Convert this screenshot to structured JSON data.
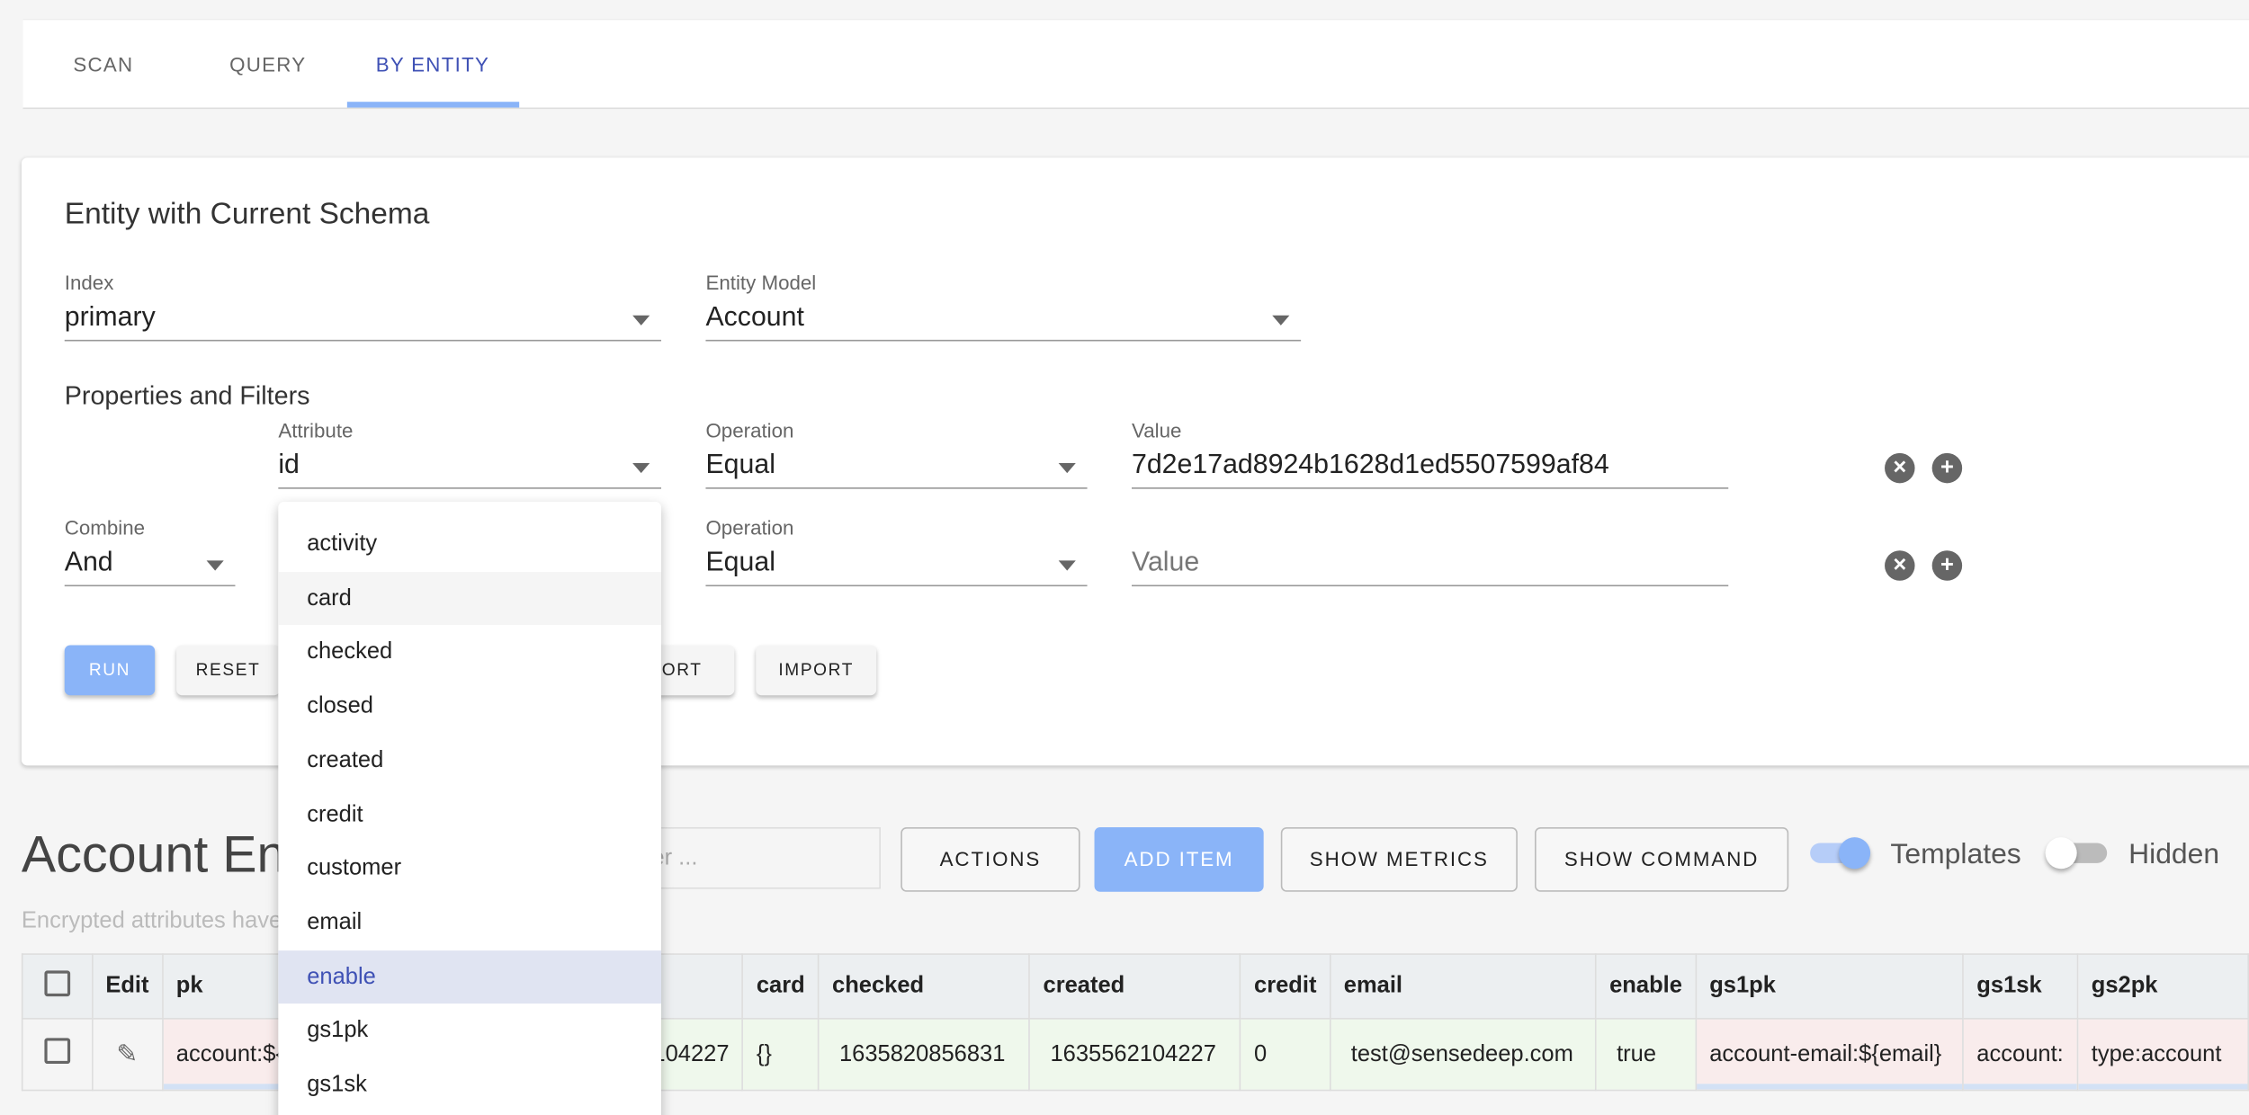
{
  "tabs": [
    {
      "label": "SCAN"
    },
    {
      "label": "QUERY"
    },
    {
      "label": "BY ENTITY",
      "active": true
    }
  ],
  "form": {
    "title": "Entity with Current Schema",
    "index": {
      "label": "Index",
      "value": "primary"
    },
    "model": {
      "label": "Entity Model",
      "value": "Account"
    },
    "filters_title": "Properties and Filters",
    "row1": {
      "attribute_label": "Attribute",
      "attribute": "id",
      "operation_label": "Operation",
      "operation": "Equal",
      "value_label": "Value",
      "value": "7d2e17ad8924b1628d1ed5507599af84"
    },
    "row2": {
      "combine_label": "Combine",
      "combine": "And",
      "operation_label": "Operation",
      "operation": "Equal",
      "value_placeholder": "Value"
    },
    "buttons": {
      "run": "RUN",
      "reset": "RESET",
      "export": "EXPORT",
      "import": "IMPORT"
    }
  },
  "attribute_menu": {
    "items": [
      "activity",
      "card",
      "checked",
      "closed",
      "created",
      "credit",
      "customer",
      "email",
      "enable",
      "gs1pk",
      "gs1sk"
    ],
    "hovered": "card",
    "selected": "enable"
  },
  "results": {
    "title": "Account Entities",
    "filter_placeholder": "Filter ...",
    "actions": "ACTIONS",
    "add_item": "ADD ITEM",
    "show_metrics": "SHOW METRICS",
    "show_command": "SHOW COMMAND",
    "templates_label": "Templates",
    "templates_on": true,
    "hidden_label": "Hidden",
    "hidden_on": false,
    "note": "Encrypted attributes have..."
  },
  "table": {
    "headers": [
      "Edit",
      "pk",
      "",
      "card",
      "checked",
      "created",
      "credit",
      "email",
      "enable",
      "gs1pk",
      "gs1sk",
      "gs2pk"
    ],
    "row": {
      "pk": "account:${id}",
      "hidden": "1635562104227",
      "card": "{}",
      "checked": "1635820856831",
      "created": "1635562104227",
      "credit": "0",
      "email": "test@sensedeep.com",
      "enable": "true",
      "gs1pk": "account-email:${email}",
      "gs1sk": "account:",
      "gs2pk": "type:account"
    }
  },
  "colors": {
    "accent": "#3f51b5",
    "primary_button": "#8ab4f8",
    "template_cell": "#f9ecec",
    "value_cell": "#eff8ec"
  }
}
